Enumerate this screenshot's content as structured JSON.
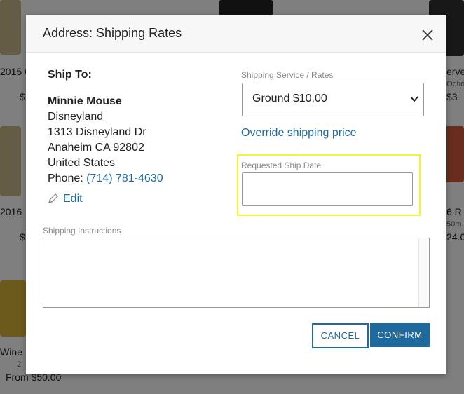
{
  "background": {
    "product_titles": [
      "2015 C",
      "2016",
      "Wine",
      "erve",
      "6 R"
    ],
    "prices": [
      "$",
      "$",
      "From $50.00",
      "$3",
      "24.0"
    ],
    "small_texts": [
      "Optio",
      "50m",
      "2"
    ]
  },
  "modal": {
    "title": "Address: Shipping Rates",
    "ship_to": {
      "heading": "Ship To:",
      "name": "Minnie Mouse",
      "company": "Disneyland",
      "street": "1313 Disneyland Dr",
      "city_line": "Anaheim CA 92802",
      "country": "United States",
      "phone_label": "Phone:",
      "phone": "(714) 781-4630",
      "edit_label": "Edit"
    },
    "shipping_service": {
      "label": "Shipping Service / Rates",
      "selected": "Ground $10.00"
    },
    "override_label": "Override shipping price",
    "ship_date": {
      "label": "Requested Ship Date",
      "value": ""
    },
    "instructions": {
      "label": "Shipping Instructions",
      "value": ""
    },
    "buttons": {
      "cancel": "CANCEL",
      "confirm": "CONFIRM"
    }
  },
  "colors": {
    "link": "#1e6a9e",
    "highlight": "#f5f52e",
    "overlay": "rgba(0,0,0,0.5)"
  }
}
